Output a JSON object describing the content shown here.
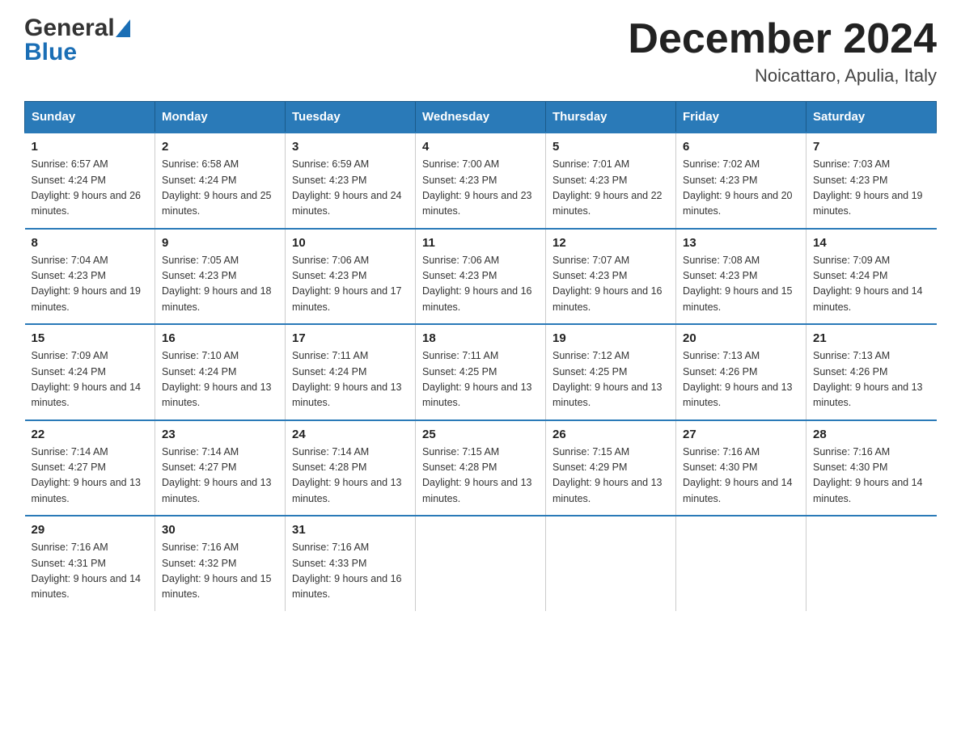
{
  "header": {
    "logo_general": "General",
    "logo_blue": "Blue",
    "month_title": "December 2024",
    "location": "Noicattaro, Apulia, Italy"
  },
  "days_of_week": [
    "Sunday",
    "Monday",
    "Tuesday",
    "Wednesday",
    "Thursday",
    "Friday",
    "Saturday"
  ],
  "weeks": [
    [
      {
        "day": "1",
        "sunrise": "Sunrise: 6:57 AM",
        "sunset": "Sunset: 4:24 PM",
        "daylight": "Daylight: 9 hours and 26 minutes."
      },
      {
        "day": "2",
        "sunrise": "Sunrise: 6:58 AM",
        "sunset": "Sunset: 4:24 PM",
        "daylight": "Daylight: 9 hours and 25 minutes."
      },
      {
        "day": "3",
        "sunrise": "Sunrise: 6:59 AM",
        "sunset": "Sunset: 4:23 PM",
        "daylight": "Daylight: 9 hours and 24 minutes."
      },
      {
        "day": "4",
        "sunrise": "Sunrise: 7:00 AM",
        "sunset": "Sunset: 4:23 PM",
        "daylight": "Daylight: 9 hours and 23 minutes."
      },
      {
        "day": "5",
        "sunrise": "Sunrise: 7:01 AM",
        "sunset": "Sunset: 4:23 PM",
        "daylight": "Daylight: 9 hours and 22 minutes."
      },
      {
        "day": "6",
        "sunrise": "Sunrise: 7:02 AM",
        "sunset": "Sunset: 4:23 PM",
        "daylight": "Daylight: 9 hours and 20 minutes."
      },
      {
        "day": "7",
        "sunrise": "Sunrise: 7:03 AM",
        "sunset": "Sunset: 4:23 PM",
        "daylight": "Daylight: 9 hours and 19 minutes."
      }
    ],
    [
      {
        "day": "8",
        "sunrise": "Sunrise: 7:04 AM",
        "sunset": "Sunset: 4:23 PM",
        "daylight": "Daylight: 9 hours and 19 minutes."
      },
      {
        "day": "9",
        "sunrise": "Sunrise: 7:05 AM",
        "sunset": "Sunset: 4:23 PM",
        "daylight": "Daylight: 9 hours and 18 minutes."
      },
      {
        "day": "10",
        "sunrise": "Sunrise: 7:06 AM",
        "sunset": "Sunset: 4:23 PM",
        "daylight": "Daylight: 9 hours and 17 minutes."
      },
      {
        "day": "11",
        "sunrise": "Sunrise: 7:06 AM",
        "sunset": "Sunset: 4:23 PM",
        "daylight": "Daylight: 9 hours and 16 minutes."
      },
      {
        "day": "12",
        "sunrise": "Sunrise: 7:07 AM",
        "sunset": "Sunset: 4:23 PM",
        "daylight": "Daylight: 9 hours and 16 minutes."
      },
      {
        "day": "13",
        "sunrise": "Sunrise: 7:08 AM",
        "sunset": "Sunset: 4:23 PM",
        "daylight": "Daylight: 9 hours and 15 minutes."
      },
      {
        "day": "14",
        "sunrise": "Sunrise: 7:09 AM",
        "sunset": "Sunset: 4:24 PM",
        "daylight": "Daylight: 9 hours and 14 minutes."
      }
    ],
    [
      {
        "day": "15",
        "sunrise": "Sunrise: 7:09 AM",
        "sunset": "Sunset: 4:24 PM",
        "daylight": "Daylight: 9 hours and 14 minutes."
      },
      {
        "day": "16",
        "sunrise": "Sunrise: 7:10 AM",
        "sunset": "Sunset: 4:24 PM",
        "daylight": "Daylight: 9 hours and 13 minutes."
      },
      {
        "day": "17",
        "sunrise": "Sunrise: 7:11 AM",
        "sunset": "Sunset: 4:24 PM",
        "daylight": "Daylight: 9 hours and 13 minutes."
      },
      {
        "day": "18",
        "sunrise": "Sunrise: 7:11 AM",
        "sunset": "Sunset: 4:25 PM",
        "daylight": "Daylight: 9 hours and 13 minutes."
      },
      {
        "day": "19",
        "sunrise": "Sunrise: 7:12 AM",
        "sunset": "Sunset: 4:25 PM",
        "daylight": "Daylight: 9 hours and 13 minutes."
      },
      {
        "day": "20",
        "sunrise": "Sunrise: 7:13 AM",
        "sunset": "Sunset: 4:26 PM",
        "daylight": "Daylight: 9 hours and 13 minutes."
      },
      {
        "day": "21",
        "sunrise": "Sunrise: 7:13 AM",
        "sunset": "Sunset: 4:26 PM",
        "daylight": "Daylight: 9 hours and 13 minutes."
      }
    ],
    [
      {
        "day": "22",
        "sunrise": "Sunrise: 7:14 AM",
        "sunset": "Sunset: 4:27 PM",
        "daylight": "Daylight: 9 hours and 13 minutes."
      },
      {
        "day": "23",
        "sunrise": "Sunrise: 7:14 AM",
        "sunset": "Sunset: 4:27 PM",
        "daylight": "Daylight: 9 hours and 13 minutes."
      },
      {
        "day": "24",
        "sunrise": "Sunrise: 7:14 AM",
        "sunset": "Sunset: 4:28 PM",
        "daylight": "Daylight: 9 hours and 13 minutes."
      },
      {
        "day": "25",
        "sunrise": "Sunrise: 7:15 AM",
        "sunset": "Sunset: 4:28 PM",
        "daylight": "Daylight: 9 hours and 13 minutes."
      },
      {
        "day": "26",
        "sunrise": "Sunrise: 7:15 AM",
        "sunset": "Sunset: 4:29 PM",
        "daylight": "Daylight: 9 hours and 13 minutes."
      },
      {
        "day": "27",
        "sunrise": "Sunrise: 7:16 AM",
        "sunset": "Sunset: 4:30 PM",
        "daylight": "Daylight: 9 hours and 14 minutes."
      },
      {
        "day": "28",
        "sunrise": "Sunrise: 7:16 AM",
        "sunset": "Sunset: 4:30 PM",
        "daylight": "Daylight: 9 hours and 14 minutes."
      }
    ],
    [
      {
        "day": "29",
        "sunrise": "Sunrise: 7:16 AM",
        "sunset": "Sunset: 4:31 PM",
        "daylight": "Daylight: 9 hours and 14 minutes."
      },
      {
        "day": "30",
        "sunrise": "Sunrise: 7:16 AM",
        "sunset": "Sunset: 4:32 PM",
        "daylight": "Daylight: 9 hours and 15 minutes."
      },
      {
        "day": "31",
        "sunrise": "Sunrise: 7:16 AM",
        "sunset": "Sunset: 4:33 PM",
        "daylight": "Daylight: 9 hours and 16 minutes."
      },
      null,
      null,
      null,
      null
    ]
  ]
}
